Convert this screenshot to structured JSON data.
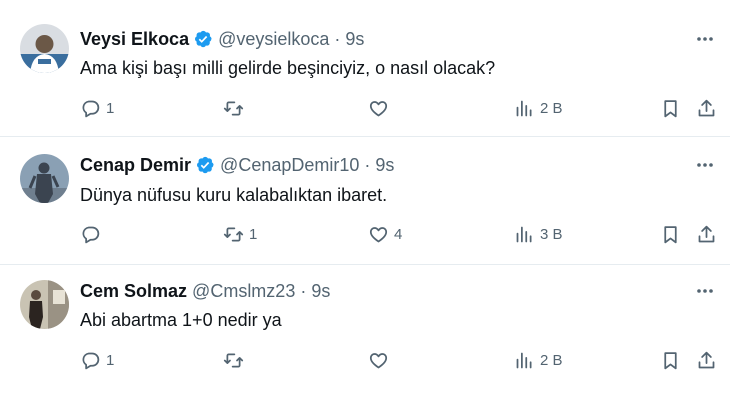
{
  "tweets": [
    {
      "name": "Veysi Elkoca",
      "verified": true,
      "handle": "@veysielkoca",
      "separator": "·",
      "time": "9s",
      "text": "Ama kişi başı milli gelirde beşinciyiz, o nasıl olacak?",
      "replies": "1",
      "retweets": "",
      "likes": "",
      "views": "2 B",
      "avatar_colors": [
        "#3a6e9e",
        "#d9dde2"
      ]
    },
    {
      "name": "Cenap Demir",
      "verified": true,
      "handle": "@CenapDemir10",
      "separator": "·",
      "time": "9s",
      "text": "Dünya nüfusu kuru kalabalıktan ibaret.",
      "replies": "",
      "retweets": "1",
      "likes": "4",
      "views": "3 B",
      "avatar_colors": [
        "#8aa0b4",
        "#3b4450"
      ]
    },
    {
      "name": "Cem Solmaz",
      "verified": false,
      "handle": "@Cmslmz23",
      "separator": "·",
      "time": "9s",
      "text": "Abi abartma 1+0 nedir ya",
      "replies": "1",
      "retweets": "",
      "likes": "",
      "views": "2 B",
      "avatar_colors": [
        "#c9c3b3",
        "#2b2420"
      ]
    }
  ],
  "colors": {
    "text_primary": "#0f1419",
    "text_secondary": "#536471",
    "verified_blue": "#1d9bf0",
    "divider": "#e6ecf0"
  },
  "icons": [
    "reply-icon",
    "retweet-icon",
    "like-icon",
    "views-icon",
    "bookmark-icon",
    "share-icon",
    "more-icon",
    "verified-badge-icon"
  ]
}
